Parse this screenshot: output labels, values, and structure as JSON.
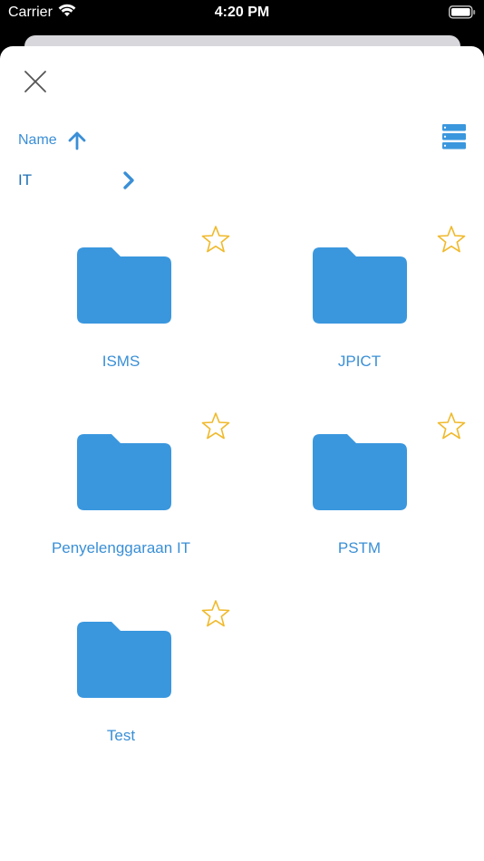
{
  "status_bar": {
    "carrier": "Carrier",
    "time": "4:20 PM"
  },
  "toolbar": {
    "close_icon": "close-icon",
    "sort_label": "Name",
    "sort_direction_icon": "arrow-up-icon",
    "view_toggle_icon": "list-view-icon"
  },
  "breadcrumb": {
    "label": "IT",
    "icon": "chevron-right-icon"
  },
  "folders": [
    {
      "name": "ISMS",
      "favorite": false
    },
    {
      "name": "JPICT",
      "favorite": false
    },
    {
      "name": "Penyelenggaraan IT",
      "favorite": false
    },
    {
      "name": "PSTM",
      "favorite": false
    },
    {
      "name": "Test",
      "favorite": false
    }
  ],
  "colors": {
    "accent": "#3a8fd6",
    "folder": "#3a97de",
    "star": "#f0b92a",
    "breadcrumb": "#1d6fb3"
  }
}
